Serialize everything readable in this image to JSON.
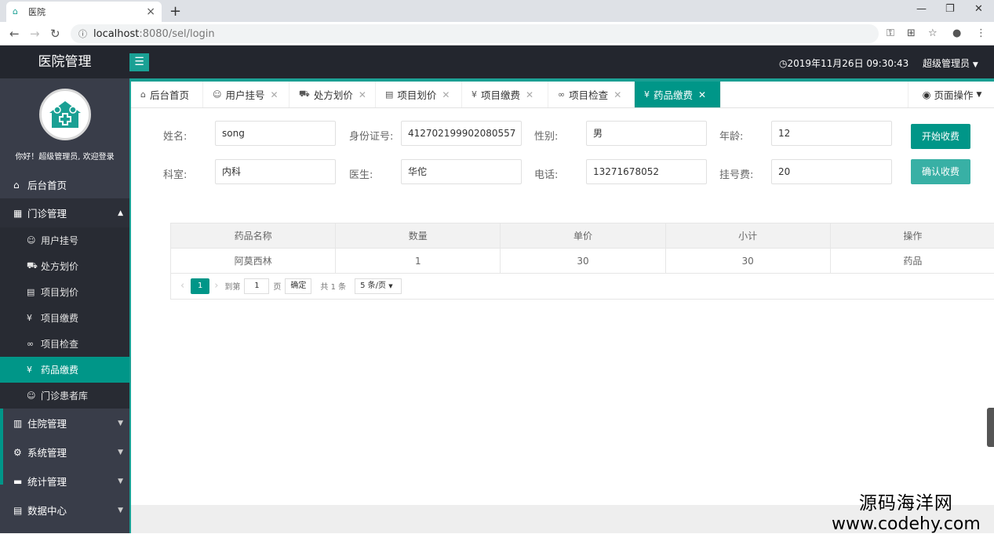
{
  "browser": {
    "tab_title": "医院",
    "url_host": "localhost",
    "url_rest": ":8080/sel/login"
  },
  "header": {
    "brand": "医院管理",
    "datetime": "2019年11月26日 09:30:43",
    "user": "超级管理员"
  },
  "sidebar": {
    "greeting": "你好！超级管理员, 欢迎登录",
    "home": "后台首页",
    "outpatient": {
      "label": "门诊管理",
      "items": [
        "用户挂号",
        "处方划价",
        "项目划价",
        "项目缴费",
        "项目检查",
        "药品缴费",
        "门诊患者库"
      ],
      "active": "药品缴费"
    },
    "groups": [
      "住院管理",
      "系统管理",
      "统计管理",
      "数据中心"
    ]
  },
  "tabs": {
    "items": [
      "后台首页",
      "用户挂号",
      "处方划价",
      "项目划价",
      "项目缴费",
      "项目检查",
      "药品缴费"
    ],
    "active": "药品缴费",
    "page_ops": "页面操作"
  },
  "form": {
    "name_label": "姓名:",
    "name": "song",
    "id_label": "身份证号:",
    "id": "412702199902080557",
    "gender_label": "性别:",
    "gender": "男",
    "age_label": "年龄:",
    "age": "12",
    "dept_label": "科室:",
    "dept": "内科",
    "doctor_label": "医生:",
    "doctor": "华佗",
    "phone_label": "电话:",
    "phone": "13271678052",
    "fee_label": "挂号费:",
    "fee": "20",
    "start_button": "开始收费",
    "confirm_button": "确认收费"
  },
  "table": {
    "headers": [
      "药品名称",
      "数量",
      "单价",
      "小计",
      "操作"
    ],
    "rows": [
      [
        "阿莫西林",
        "1",
        "30",
        "30",
        "药品"
      ]
    ]
  },
  "pager": {
    "current": "1",
    "goto": "到第",
    "page_input": "1",
    "page_unit": "页",
    "confirm": "确定",
    "total": "共 1 条",
    "size": "5 条/页"
  },
  "watermark": {
    "line1": "源码海洋网",
    "line2": "www.codehy.com"
  },
  "colors": {
    "accent": "#009688",
    "topbar": "#23262e",
    "sidebar": "#393d49"
  }
}
